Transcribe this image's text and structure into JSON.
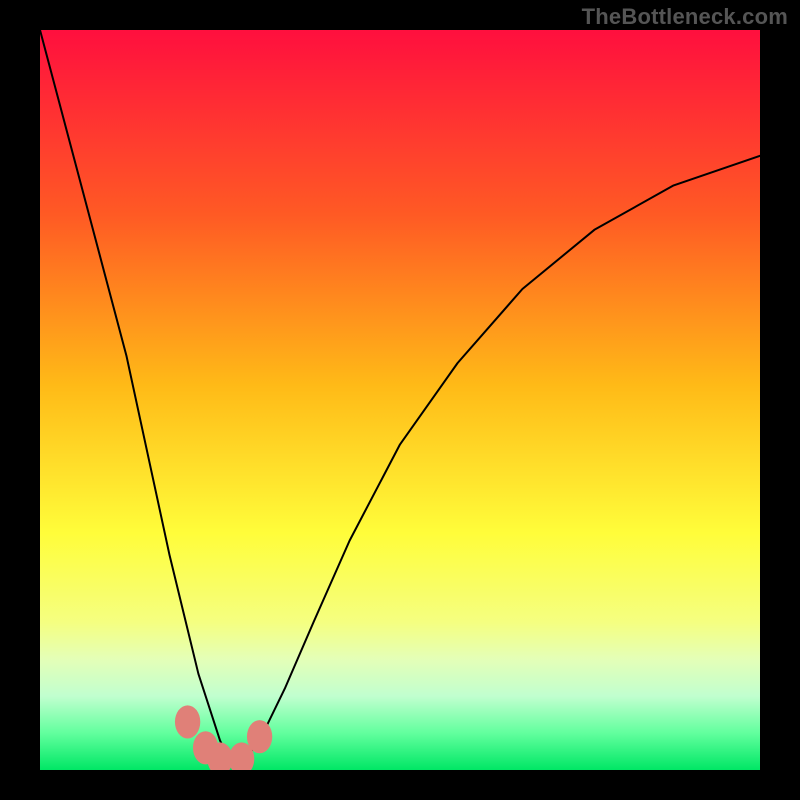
{
  "attribution": "TheBottleneck.com",
  "chart_data": {
    "type": "line",
    "title": "",
    "xlabel": "",
    "ylabel": "",
    "xlim": [
      0,
      100
    ],
    "ylim": [
      0,
      100
    ],
    "grid": false,
    "legend": false,
    "background": {
      "type": "vertical-gradient",
      "stops": [
        {
          "pos": 0,
          "color": "#ff0f3e"
        },
        {
          "pos": 25,
          "color": "#ff5a24"
        },
        {
          "pos": 48,
          "color": "#ffba17"
        },
        {
          "pos": 68,
          "color": "#fffd3a"
        },
        {
          "pos": 80,
          "color": "#f5ff80"
        },
        {
          "pos": 85,
          "color": "#e4ffb7"
        },
        {
          "pos": 90,
          "color": "#c1ffcf"
        },
        {
          "pos": 95,
          "color": "#62ff9e"
        },
        {
          "pos": 100,
          "color": "#00e765"
        }
      ]
    },
    "series": [
      {
        "name": "bottleneck-curve",
        "color": "#000000",
        "stroke_width": 2,
        "x": [
          0,
          3,
          6,
          9,
          12,
          14,
          16,
          18,
          20,
          22,
          24,
          25,
          26,
          27,
          28,
          29,
          31,
          34,
          38,
          43,
          50,
          58,
          67,
          77,
          88,
          100
        ],
        "y": [
          100,
          89,
          78,
          67,
          56,
          47,
          38,
          29,
          21,
          13,
          7,
          4,
          2,
          1,
          1,
          2,
          5,
          11,
          20,
          31,
          44,
          55,
          65,
          73,
          79,
          83
        ]
      }
    ],
    "markers": [
      {
        "x": 20.5,
        "y": 6.5,
        "r": 1.6,
        "color": "#e08078"
      },
      {
        "x": 23.0,
        "y": 3.0,
        "r": 1.6,
        "color": "#e08078"
      },
      {
        "x": 25.0,
        "y": 1.5,
        "r": 1.6,
        "color": "#e08078"
      },
      {
        "x": 28.0,
        "y": 1.5,
        "r": 1.6,
        "color": "#e08078"
      },
      {
        "x": 30.5,
        "y": 4.5,
        "r": 1.6,
        "color": "#e08078"
      }
    ]
  }
}
